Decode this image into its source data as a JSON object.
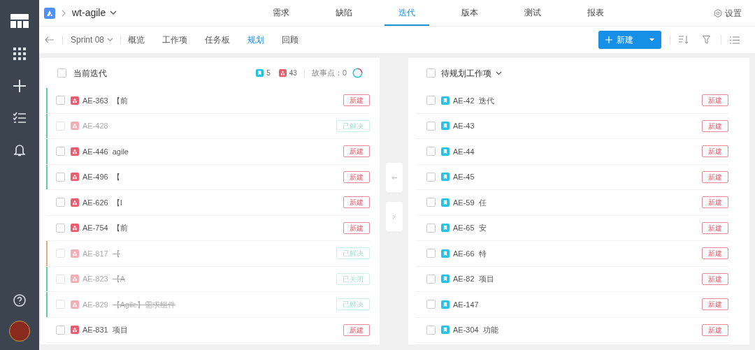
{
  "header": {
    "project": "wt-agile",
    "tabs": [
      {
        "label": "需求",
        "selected": false
      },
      {
        "label": "缺陷",
        "selected": false
      },
      {
        "label": "迭代",
        "selected": true
      },
      {
        "label": "版本",
        "selected": false
      },
      {
        "label": "测试",
        "selected": false
      },
      {
        "label": "报表",
        "selected": false
      }
    ],
    "settings": "设置"
  },
  "subnav": {
    "sprint": "Sprint 08",
    "tabs": [
      {
        "label": "概览",
        "selected": false
      },
      {
        "label": "工作项",
        "selected": false
      },
      {
        "label": "任务板",
        "selected": false
      },
      {
        "label": "规划",
        "selected": true
      },
      {
        "label": "回顾",
        "selected": false
      }
    ],
    "new_button": "新建"
  },
  "current": {
    "title": "当前迭代",
    "checked": false,
    "story_count": "5",
    "bug_count": "43",
    "points_label": "故事点：0",
    "rows": [
      {
        "kind": "bug",
        "id": "AE-363",
        "title": "【前",
        "status": "新建",
        "done": false,
        "checked": false,
        "color": "#5ccf9f"
      },
      {
        "kind": "bug",
        "id": "AE-428",
        "status": "已解决",
        "done": true,
        "checked": false,
        "color": "#5ccf9f"
      },
      {
        "kind": "bug",
        "id": "AE-446",
        "title": "agile",
        "status": "新建",
        "done": false,
        "checked": false,
        "color": "#5ccf9f"
      },
      {
        "kind": "bug",
        "id": "AE-496",
        "title": "【",
        "status": "新建",
        "done": false,
        "checked": false,
        "color": "#5ccf9f"
      },
      {
        "kind": "bug",
        "id": "AE-626",
        "title": "【I",
        "status": "新建",
        "done": false,
        "checked": false
      },
      {
        "kind": "bug",
        "id": "AE-754",
        "title": "【前",
        "status": "新建",
        "done": false,
        "checked": false
      },
      {
        "kind": "bug",
        "id": "AE-817",
        "title": "【",
        "status": "已解决",
        "done": true,
        "checked": false,
        "color": "#f0a878"
      },
      {
        "kind": "bug",
        "id": "AE-823",
        "title": "【A",
        "status": "已关闭",
        "done": true,
        "checked": false,
        "color": "#5ccf9f"
      },
      {
        "kind": "bug",
        "id": "AE-829",
        "title": "【Agile】需求组件",
        "status": "已解决",
        "done": true,
        "checked": false,
        "color": "#5ccf9f"
      },
      {
        "kind": "bug",
        "id": "AE-831",
        "title": "项目",
        "status": "新建",
        "done": false,
        "checked": false
      }
    ]
  },
  "backlog": {
    "title": "待规划工作项",
    "checked": false,
    "rows": [
      {
        "kind": "story",
        "id": "AE-42",
        "title": "迭代",
        "status": "新建",
        "done": false,
        "checked": false
      },
      {
        "kind": "story",
        "id": "AE-43",
        "status": "新建",
        "done": false,
        "checked": false
      },
      {
        "kind": "story",
        "id": "AE-44",
        "status": "新建",
        "done": false,
        "checked": false
      },
      {
        "kind": "story",
        "id": "AE-45",
        "status": "新建",
        "done": false,
        "checked": false
      },
      {
        "kind": "story",
        "id": "AE-59",
        "title": "任",
        "status": "新建",
        "done": false,
        "checked": false
      },
      {
        "kind": "story",
        "id": "AE-65",
        "title": "安",
        "status": "新建",
        "done": false,
        "checked": false
      },
      {
        "kind": "story",
        "id": "AE-66",
        "title": "特",
        "status": "新建",
        "done": false,
        "checked": false
      },
      {
        "kind": "story",
        "id": "AE-82",
        "title": "项目",
        "status": "新建",
        "done": false,
        "checked": false
      },
      {
        "kind": "story",
        "id": "AE-147",
        "status": "新建",
        "done": false,
        "checked": false
      },
      {
        "kind": "story",
        "id": "AE-304",
        "title": "功能",
        "status": "新建",
        "done": false,
        "checked": false
      }
    ]
  }
}
